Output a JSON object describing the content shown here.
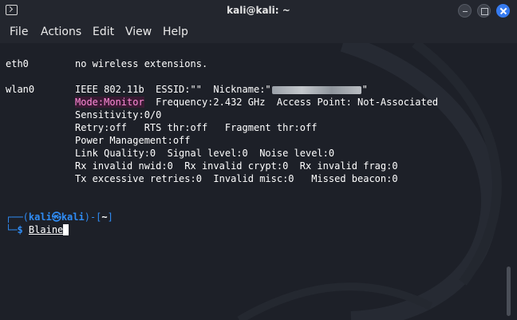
{
  "window": {
    "title": "kali@kali: ~"
  },
  "menu": [
    "File",
    "Actions",
    "Edit",
    "View",
    "Help"
  ],
  "output": {
    "eth0_iface": "eth0",
    "eth0_msg": "no wireless extensions.",
    "wlan0_iface": "wlan0",
    "wlan0_line1_a": "IEEE 802.11b  ESSID:\"\"  Nickname:\"",
    "wlan0_line1_b": "\"",
    "mode": "Mode:Monitor",
    "mode_rest": "  Frequency:2.432 GHz  Access Point: Not-Associated",
    "lines": [
      "Sensitivity:0/0",
      "Retry:off   RTS thr:off   Fragment thr:off",
      "Power Management:off",
      "Link Quality:0  Signal level:0  Noise level:0",
      "Rx invalid nwid:0  Rx invalid crypt:0  Rx invalid frag:0",
      "Tx excessive retries:0  Invalid misc:0   Missed beacon:0"
    ]
  },
  "prompt": {
    "top_left": "┌──(",
    "user": "kali",
    "at": "㉿",
    "host": "kali",
    "mid": ")-[",
    "dir": "~",
    "end": "]",
    "bottom_left": "└─",
    "dollar": "$",
    "command": "Blaine"
  }
}
